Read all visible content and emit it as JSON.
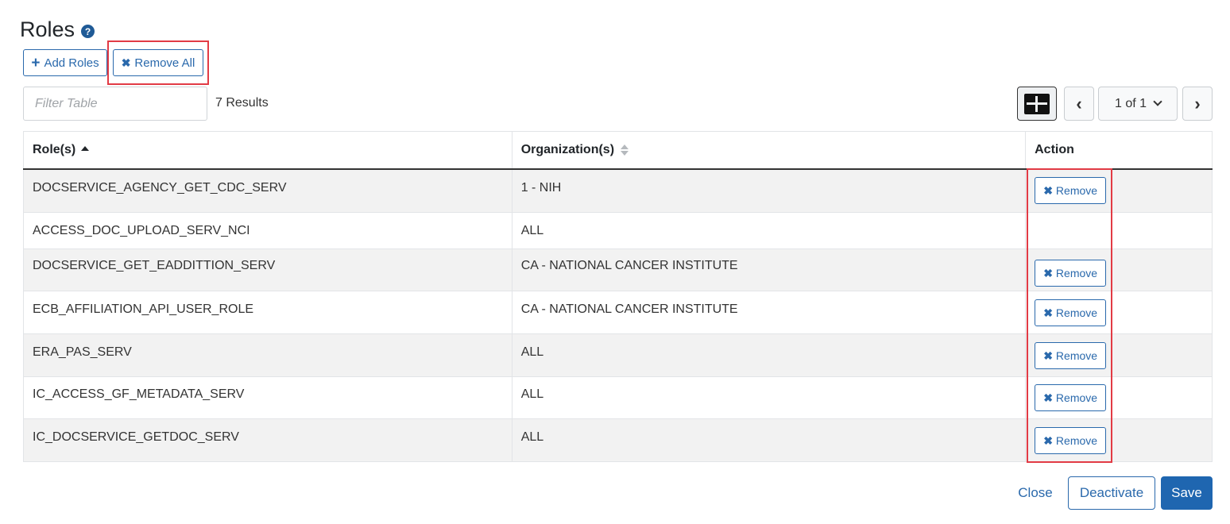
{
  "section": {
    "title": "Roles",
    "help_icon": "?"
  },
  "toolbar": {
    "add_label": "Add Roles",
    "add_icon": "+",
    "remove_all_label": "Remove All",
    "remove_icon": "✖"
  },
  "filter": {
    "placeholder": "Filter Table",
    "value": ""
  },
  "results_text": "7 Results",
  "pagination": {
    "page_text": "1 of 1",
    "prev_icon": "‹",
    "next_icon": "›",
    "dropdown_icon": "⌄"
  },
  "table": {
    "headers": {
      "role": "Role(s)",
      "organization": "Organization(s)",
      "action": "Action"
    },
    "rows": [
      {
        "role": "DOCSERVICE_AGENCY_GET_CDC_SERV",
        "organization": "1 - NIH",
        "action": "Remove"
      },
      {
        "role": "ACCESS_DOC_UPLOAD_SERV_NCI",
        "organization": "ALL",
        "action": ""
      },
      {
        "role": "DOCSERVICE_GET_EADDITTION_SERV",
        "organization": "CA - NATIONAL CANCER INSTITUTE",
        "action": "Remove"
      },
      {
        "role": "ECB_AFFILIATION_API_USER_ROLE",
        "organization": "CA - NATIONAL CANCER INSTITUTE",
        "action": "Remove"
      },
      {
        "role": "ERA_PAS_SERV",
        "organization": "ALL",
        "action": "Remove"
      },
      {
        "role": "IC_ACCESS_GF_METADATA_SERV",
        "organization": "ALL",
        "action": "Remove"
      },
      {
        "role": "IC_DOCSERVICE_GETDOC_SERV",
        "organization": "ALL",
        "action": "Remove"
      }
    ]
  },
  "footer": {
    "close_label": "Close",
    "deactivate_label": "Deactivate",
    "save_label": "Save"
  },
  "colors": {
    "accent": "#2a69ac",
    "primary_button": "#1f66b0",
    "highlight_box": "#e23b45",
    "row_stripe": "#f2f2f2"
  }
}
